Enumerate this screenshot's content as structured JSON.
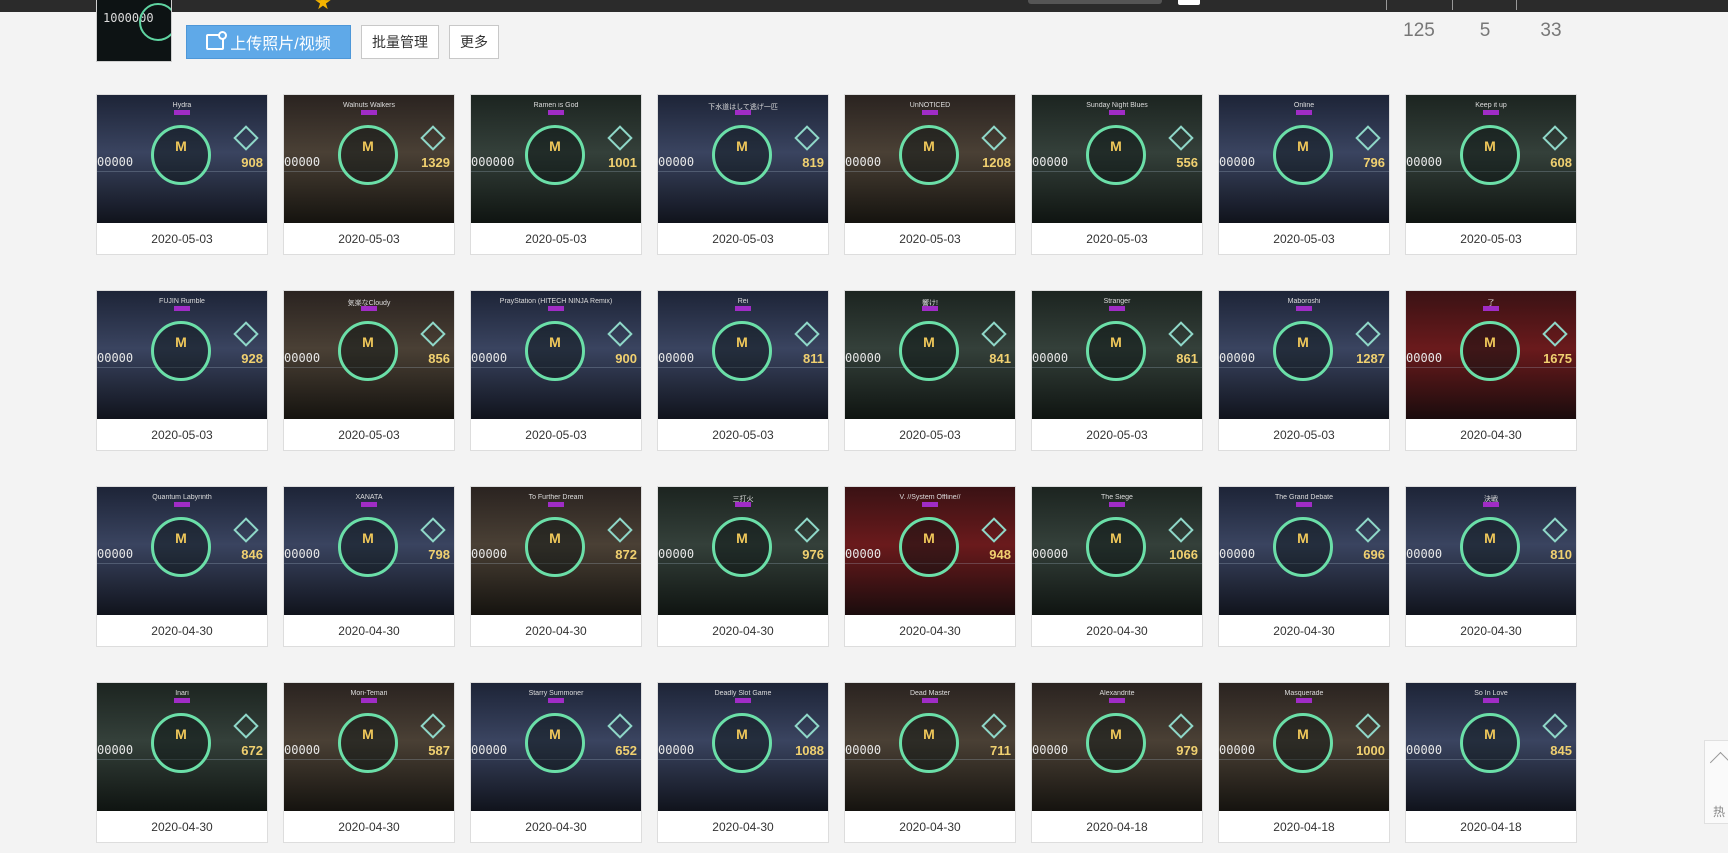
{
  "toolbar": {
    "upload_label": "上传照片/视频",
    "batch_label": "批量管理",
    "more_label": "更多"
  },
  "album": {
    "thumb_score": "1000000"
  },
  "stats": [
    "125",
    "5",
    "33"
  ],
  "side": {
    "hot_label": "热"
  },
  "rows": [
    [
      {
        "song": "Hydra",
        "score": "00000",
        "combo": "908",
        "date": "2020-05-03",
        "theme": "blue"
      },
      {
        "song": "Walnuts Walkers",
        "score": "00000",
        "combo": "1329",
        "date": "2020-05-03",
        "theme": "warm"
      },
      {
        "song": "Ramen is God",
        "score": "000000",
        "combo": "1001",
        "date": "2020-05-03",
        "theme": "green"
      },
      {
        "song": "下水道はして逃げ一匹",
        "score": "00000",
        "combo": "819",
        "date": "2020-05-03",
        "theme": "blue"
      },
      {
        "song": "UnNOTICED",
        "score": "00000",
        "combo": "1208",
        "date": "2020-05-03",
        "theme": "warm"
      },
      {
        "song": "Sunday Night Blues",
        "score": "00000",
        "combo": "556",
        "date": "2020-05-03",
        "theme": "green"
      },
      {
        "song": "Online",
        "score": "00000",
        "combo": "796",
        "date": "2020-05-03",
        "theme": "blue"
      },
      {
        "song": "Keep it up",
        "score": "00000",
        "combo": "608",
        "date": "2020-05-03",
        "theme": "green"
      }
    ],
    [
      {
        "song": "FUJIN Rumble",
        "score": "00000",
        "combo": "928",
        "date": "2020-05-03",
        "theme": "blue"
      },
      {
        "song": "気楽なCloudy",
        "score": "00000",
        "combo": "856",
        "date": "2020-05-03",
        "theme": "warm"
      },
      {
        "song": "PrayStation (HITECH NINJA Remix)",
        "score": "00000",
        "combo": "900",
        "date": "2020-05-03",
        "theme": "blue"
      },
      {
        "song": "Rei",
        "score": "00000",
        "combo": "811",
        "date": "2020-05-03",
        "theme": "blue"
      },
      {
        "song": "響け!",
        "score": "00000",
        "combo": "841",
        "date": "2020-05-03",
        "theme": "green"
      },
      {
        "song": "Stranger",
        "score": "00000",
        "combo": "861",
        "date": "2020-05-03",
        "theme": "green"
      },
      {
        "song": "Maboroshi",
        "score": "00000",
        "combo": "1287",
        "date": "2020-05-03",
        "theme": "blue"
      },
      {
        "song": "了",
        "score": "00000",
        "combo": "1675",
        "date": "2020-04-30",
        "theme": "red"
      }
    ],
    [
      {
        "song": "Quantum Labyrinth",
        "score": "00000",
        "combo": "846",
        "date": "2020-04-30",
        "theme": "blue"
      },
      {
        "song": "XANATA",
        "score": "00000",
        "combo": "798",
        "date": "2020-04-30",
        "theme": "blue"
      },
      {
        "song": "To Further Dream",
        "score": "00000",
        "combo": "872",
        "date": "2020-04-30",
        "theme": "warm"
      },
      {
        "song": "三打火",
        "score": "00000",
        "combo": "976",
        "date": "2020-04-30",
        "theme": "green"
      },
      {
        "song": "V. //System Offline//",
        "score": "00000",
        "combo": "948",
        "date": "2020-04-30",
        "theme": "red"
      },
      {
        "song": "The Siege",
        "score": "00000",
        "combo": "1066",
        "date": "2020-04-30",
        "theme": "green"
      },
      {
        "song": "The Grand Debate",
        "score": "00000",
        "combo": "696",
        "date": "2020-04-30",
        "theme": "blue"
      },
      {
        "song": "決戦",
        "score": "00000",
        "combo": "810",
        "date": "2020-04-30",
        "theme": "blue"
      }
    ],
    [
      {
        "song": "Inari",
        "score": "00000",
        "combo": "672",
        "date": "2020-04-30",
        "theme": "green"
      },
      {
        "song": "Mori-Temari",
        "score": "00000",
        "combo": "587",
        "date": "2020-04-30",
        "theme": "warm"
      },
      {
        "song": "Starry Summoner",
        "score": "00000",
        "combo": "652",
        "date": "2020-04-30",
        "theme": "blue"
      },
      {
        "song": "Deadly Slot Game",
        "score": "00000",
        "combo": "1088",
        "date": "2020-04-30",
        "theme": "blue"
      },
      {
        "song": "Dead Master",
        "score": "00000",
        "combo": "711",
        "date": "2020-04-30",
        "theme": "warm"
      },
      {
        "song": "Alexandrite",
        "score": "00000",
        "combo": "979",
        "date": "2020-04-18",
        "theme": "warm"
      },
      {
        "song": "Masquerade",
        "score": "00000",
        "combo": "1000",
        "date": "2020-04-18",
        "theme": "warm"
      },
      {
        "song": "So In Love",
        "score": "00000",
        "combo": "845",
        "date": "2020-04-18",
        "theme": "blue"
      }
    ]
  ]
}
